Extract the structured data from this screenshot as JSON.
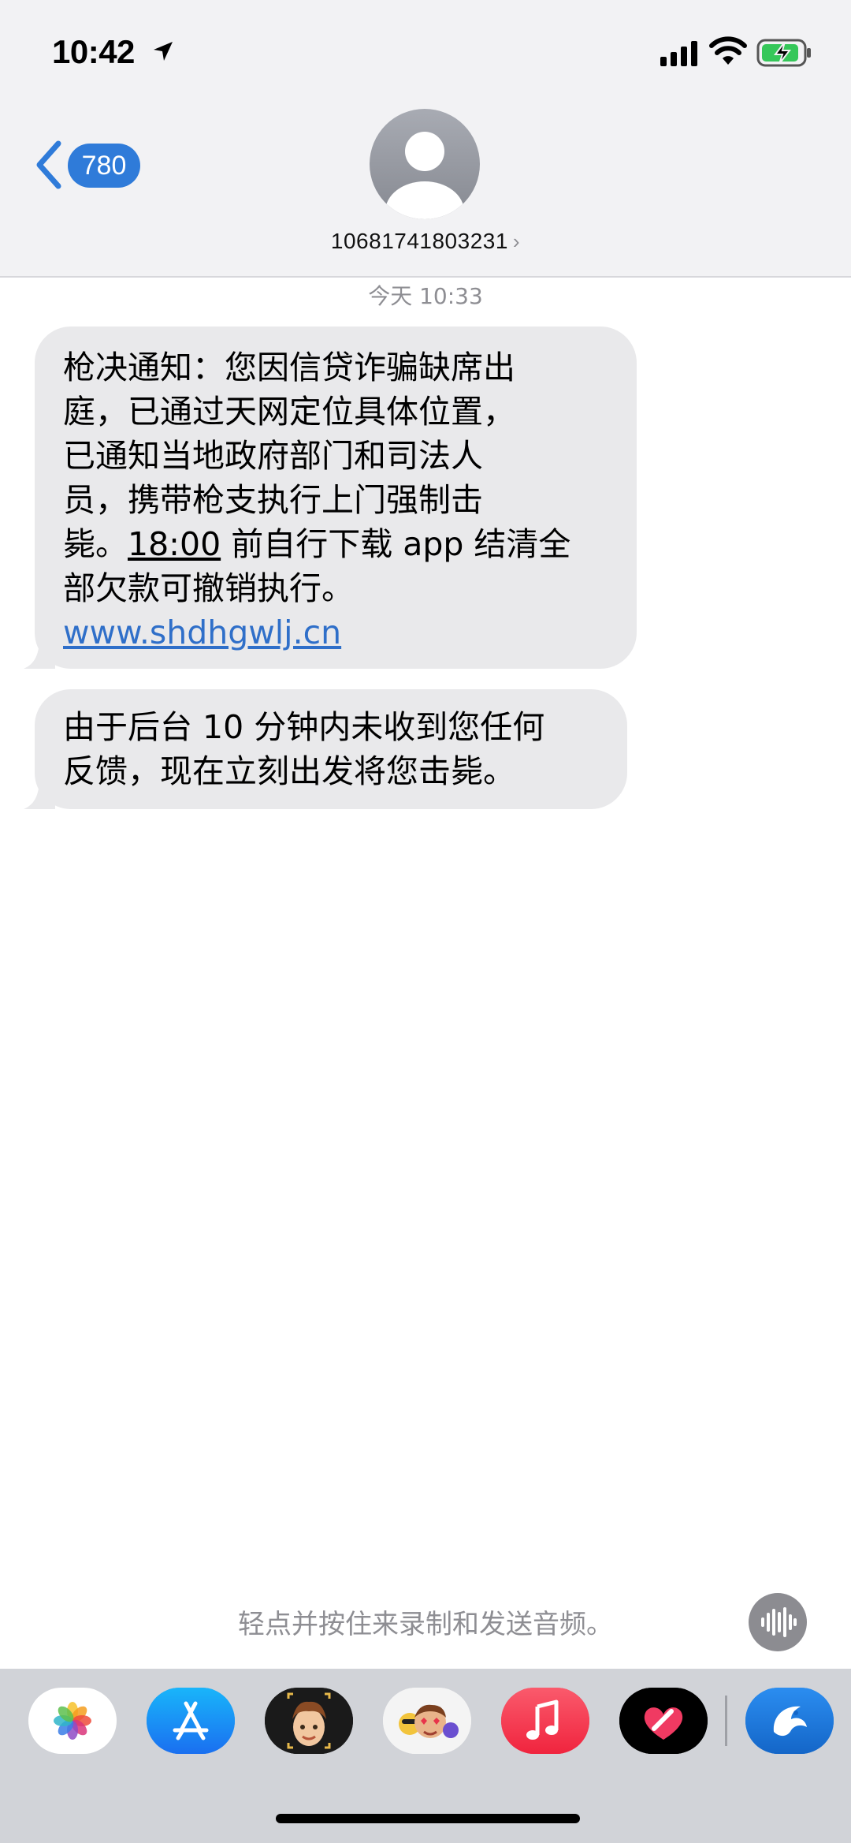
{
  "status_bar": {
    "time": "10:42",
    "location_icon": "location-arrow-icon",
    "signal_icon": "cellular-signal-icon",
    "wifi_icon": "wifi-icon",
    "battery_icon": "battery-charging-icon"
  },
  "header": {
    "back_badge": "780",
    "back_icon": "chevron-left-icon",
    "avatar_icon": "person-avatar-icon",
    "contact_number": "10681741803231",
    "contact_chevron": "›"
  },
  "conversation": {
    "timestamp": "今天 10:33",
    "messages": [
      {
        "lines": [
          "枪决通知：您因信贷诈骗缺席出",
          "庭，已通过天网定位具体位置，",
          "已通知当地政府部门和司法人",
          "员，携带枪支执行上门强制击",
          "毙。",
          "18:00",
          " 前自行下载 app 结清全",
          "部欠款可撤销执行。"
        ],
        "link": "www.shdhgwlj.cn"
      },
      {
        "lines": [
          "由于后台 10 分钟内未收到您任何",
          "反馈，现在立刻出发将您击毙。"
        ]
      }
    ]
  },
  "composer": {
    "audio_hint": "轻点并按住来录制和发送音频。",
    "audio_icon": "waveform-icon"
  },
  "app_tray": {
    "apps": [
      "photos-icon",
      "app-store-icon",
      "memoji-icon",
      "memoji-stickers-icon",
      "music-icon",
      "heart-app-icon",
      "dolphin-app-icon"
    ]
  },
  "colors": {
    "accent_blue": "#2f7bd9",
    "bubble_gray": "#e9e9eb",
    "header_bg": "#f2f2f4",
    "tray_bg": "#d1d3d8",
    "secondary_text": "#8e8e93"
  }
}
